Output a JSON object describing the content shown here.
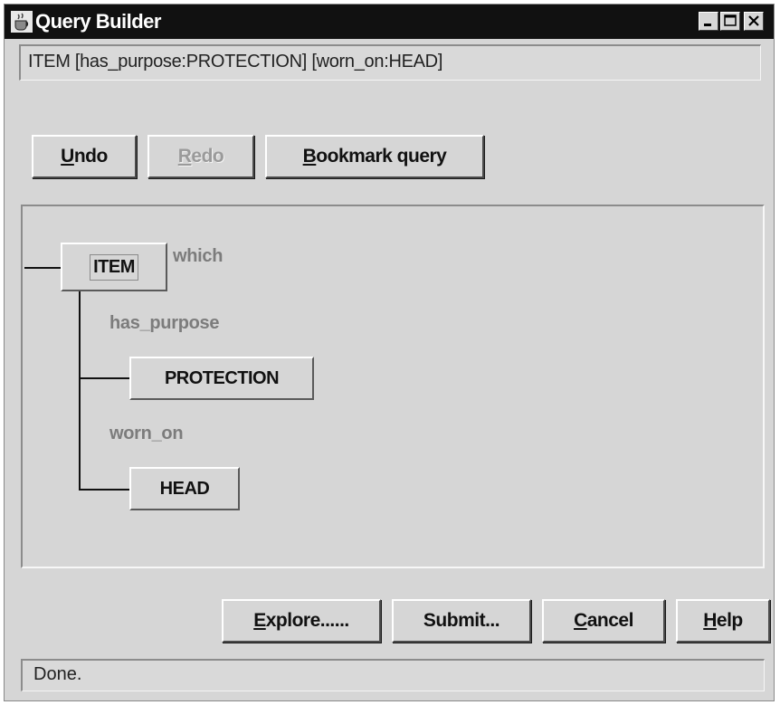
{
  "window": {
    "title": "Query Builder",
    "icons": {
      "app": "coffee-cup-icon",
      "minimize": "minimize-icon",
      "maximize": "maximize-icon",
      "close": "close-icon"
    }
  },
  "query": {
    "value": "ITEM [has_purpose:PROTECTION] [worn_on:HEAD]"
  },
  "toolbar": {
    "undo": {
      "pre": "",
      "mnemonic": "U",
      "post": "ndo"
    },
    "redo": {
      "pre": "",
      "mnemonic": "R",
      "post": "edo",
      "disabled": true
    },
    "bookmark": {
      "pre": "",
      "mnemonic": "B",
      "post": "ookmark query"
    }
  },
  "tree": {
    "root": {
      "label": "ITEM",
      "qualifier": "which"
    },
    "relations": [
      {
        "label": "has_purpose",
        "target": "PROTECTION"
      },
      {
        "label": "worn_on",
        "target": "HEAD"
      }
    ]
  },
  "actions": {
    "explore": {
      "pre": "",
      "mnemonic": "E",
      "post": "xplore......"
    },
    "submit": {
      "pre": "",
      "mnemonic": "",
      "post": "Submit..."
    },
    "cancel": {
      "pre": "",
      "mnemonic": "C",
      "post": "ancel"
    },
    "help": {
      "pre": "",
      "mnemonic": "H",
      "post": "elp"
    }
  },
  "status": {
    "text": "Done."
  }
}
